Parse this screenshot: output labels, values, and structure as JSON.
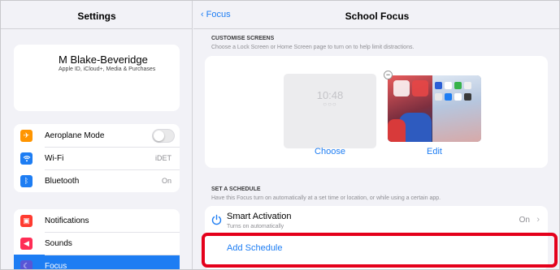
{
  "sidebar": {
    "title": "Settings",
    "profile": {
      "name": "M Blake-Beveridge",
      "subtitle": "Apple ID, iCloud+, Media & Purchases"
    },
    "group1": [
      {
        "label": "Aeroplane Mode",
        "value": "",
        "icon": "airplane-icon",
        "color": "#ff9500",
        "glyph": "✈"
      },
      {
        "label": "Wi-Fi",
        "value": "iDET",
        "icon": "wifi-icon",
        "color": "#1d7df3",
        "glyph": "≋"
      },
      {
        "label": "Bluetooth",
        "value": "On",
        "icon": "bluetooth-icon",
        "color": "#1d7df3",
        "glyph": "ᛒ"
      }
    ],
    "group2": [
      {
        "label": "Notifications",
        "icon": "notifications-icon",
        "color": "#ff3b30",
        "glyph": "▣"
      },
      {
        "label": "Sounds",
        "icon": "sounds-icon",
        "color": "#ff2d55",
        "glyph": "◀"
      },
      {
        "label": "Focus",
        "icon": "focus-moon-icon",
        "color": "#5856d6",
        "glyph": "☾"
      }
    ]
  },
  "main": {
    "back_label": "Focus",
    "title": "School Focus",
    "customise": {
      "header": "CUSTOMISE SCREENS",
      "footer": "Choose a Lock Screen or Home Screen page to turn on to help limit distractions.",
      "lock_time": "10:48",
      "lock_dots": "○○○",
      "choose_label": "Choose",
      "edit_label": "Edit"
    },
    "schedule": {
      "header": "SET A SCHEDULE",
      "footer": "Have this Focus turn on automatically at a set time or location, or while using a certain app.",
      "smart_title": "Smart Activation",
      "smart_sub": "Turns on automatically",
      "smart_value": "On",
      "add_label": "Add Schedule"
    }
  },
  "colors": {
    "accent": "#1d7df3",
    "highlight": "#e4001b"
  }
}
